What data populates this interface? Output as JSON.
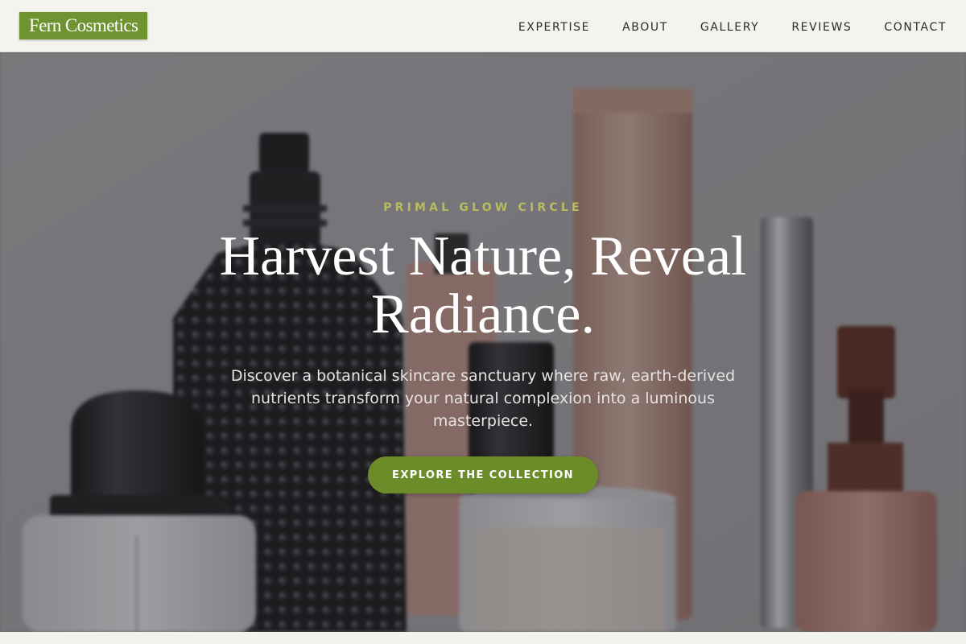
{
  "nav": {
    "brand": "Fern Cosmetics",
    "links": [
      {
        "label": "EXPERTISE"
      },
      {
        "label": "ABOUT"
      },
      {
        "label": "GALLERY"
      },
      {
        "label": "REVIEWS"
      },
      {
        "label": "CONTACT"
      }
    ]
  },
  "hero": {
    "eyebrow": "PRIMAL GLOW CIRCLE",
    "headline": "Harvest Nature, Reveal Radiance.",
    "subtext": "Discover a botanical skincare sanctuary where raw, earth-derived nutrients transform your natural complexion into a luminous masterpiece.",
    "cta_label": "EXPLORE THE COLLECTION",
    "background_label": "wildlife.beauty"
  },
  "colors": {
    "brand_green": "#6f9330",
    "cta_green": "#6c8c2a",
    "eyebrow_olive": "#b9bd5e",
    "nav_bg": "#f4f4ef"
  }
}
